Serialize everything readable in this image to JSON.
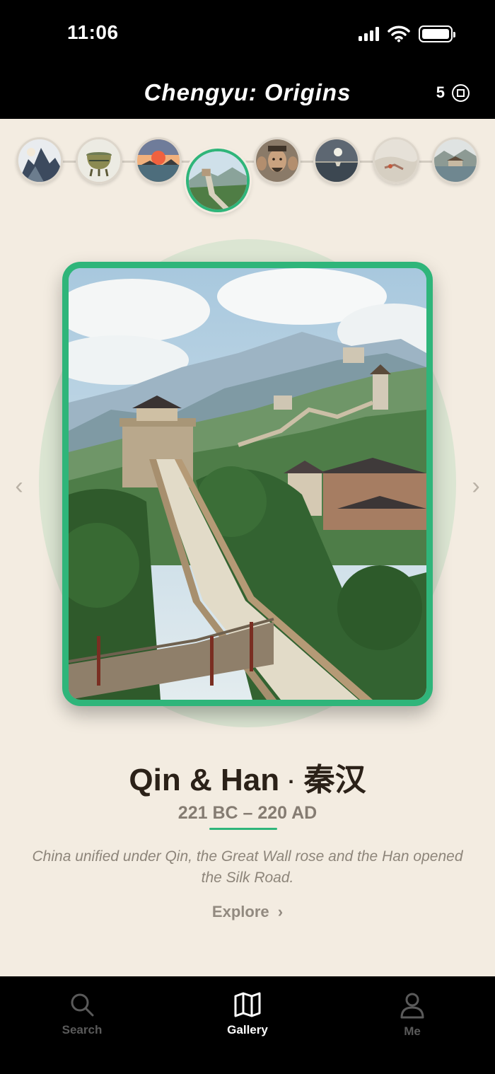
{
  "status_bar": {
    "time": "11:06"
  },
  "header": {
    "title": "Chengyu: Origins",
    "coins": "5"
  },
  "timeline": {
    "eras": [
      "mountain",
      "bronze-vessel",
      "sunset-scene",
      "great-wall",
      "emperor",
      "moon-lake",
      "misty-landscape",
      "river-village"
    ],
    "active_index": 3
  },
  "era": {
    "title": "Qin & Han",
    "separator": "·",
    "title_cn": "秦汉",
    "dates": "221 BC – 220 AD",
    "description": "China unified under Qin, the Great Wall rose and the Han opened the Silk Road.",
    "explore_label": "Explore"
  },
  "bottom_nav": {
    "search_label": "Search",
    "gallery_label": "Gallery",
    "me_label": "Me"
  },
  "colors": {
    "accent": "#2fb57a",
    "background": "#f3ece1"
  }
}
